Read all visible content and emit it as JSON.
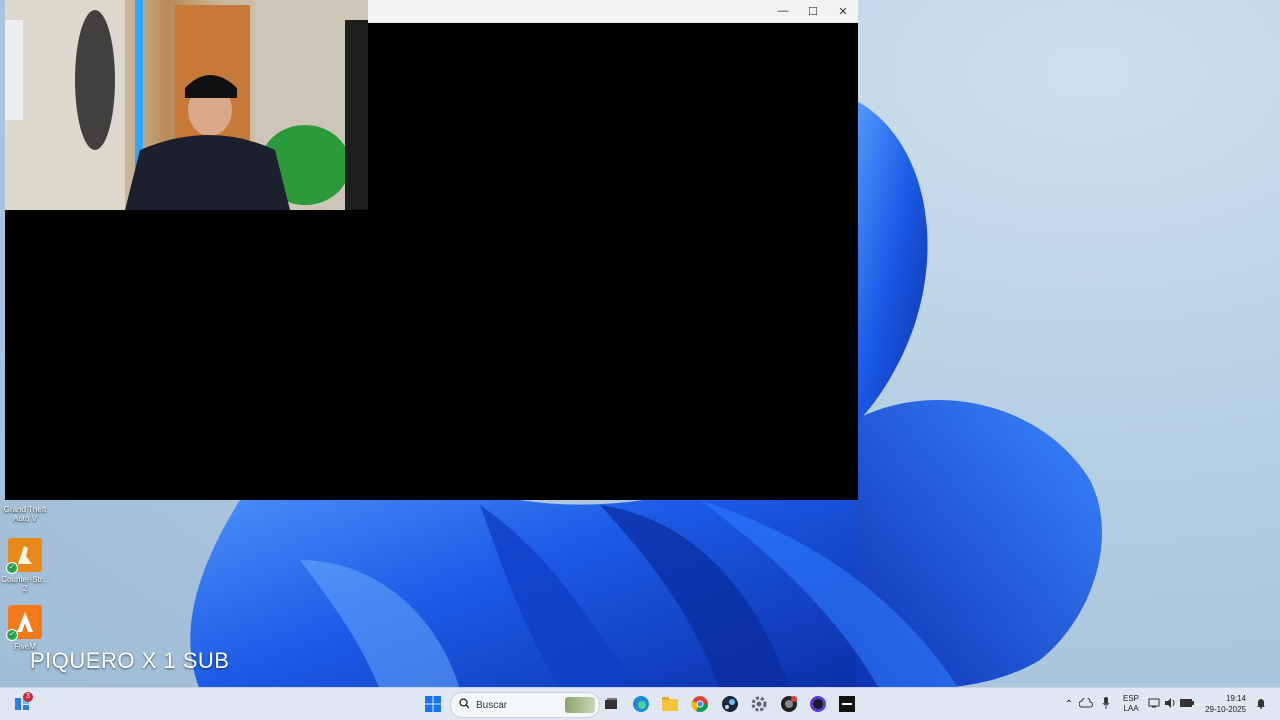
{
  "desktop": {
    "icons": [
      {
        "label": "Grand Theft Auto V",
        "icon": "gta-icon"
      },
      {
        "label": "Counter-Str... 2",
        "icon": "counter-strike-icon"
      },
      {
        "label": "FiveM",
        "icon": "fivem-icon"
      }
    ]
  },
  "window": {
    "controls": {
      "minimize": "—",
      "maximize": "☐",
      "close": "✕"
    }
  },
  "overlay": {
    "text": "PIQUERO X 1 SUB"
  },
  "taskbar": {
    "widgets_badge": "3",
    "search_placeholder": "Buscar",
    "pinned": [
      "windows-start-icon",
      "search-icon",
      "task-view-icon",
      "edge-icon",
      "file-explorer-icon",
      "chrome-icon",
      "steam-icon",
      "settings-icon",
      "app-icon",
      "obs-icon",
      "kick-icon"
    ],
    "tray": {
      "lang_line1": "ESP",
      "lang_line2": "LAA",
      "time": "19:14",
      "date": "29-10-2025"
    }
  },
  "colors": {
    "wallpaper_blue": "#1f5fe0",
    "taskbar": "#dfe8f2",
    "window_bg": "#000000"
  }
}
